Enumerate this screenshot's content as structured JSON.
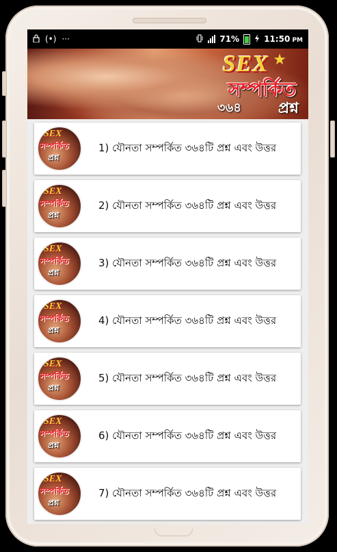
{
  "status_bar": {
    "left_icons": [
      "lock-icon",
      "hotspot-icon",
      "more-icon"
    ],
    "hotspot_symbol": "(•)",
    "more_symbol": "···",
    "battery_percent": "71%",
    "time": "11:50",
    "am_pm": "PM"
  },
  "banner": {
    "sex_text": "SEX",
    "title_line1": "সম্পর্কিত",
    "title_line2": "প্রশ্ন",
    "number": "৩৬৪"
  },
  "thumb": {
    "line1": "SEX",
    "line2": "সম্পর্কিত",
    "line3": "প্রশ্ন"
  },
  "items": [
    {
      "label": "1) যৌনতা সম্পর্কিত ৩৬৪টি প্রশ্ন এবং উত্তর"
    },
    {
      "label": "2) যৌনতা সম্পর্কিত ৩৬৪টি প্রশ্ন এবং উত্তর"
    },
    {
      "label": "3) যৌনতা সম্পর্কিত ৩৬৪টি প্রশ্ন এবং উত্তর"
    },
    {
      "label": "4) যৌনতা সম্পর্কিত ৩৬৪টি প্রশ্ন এবং উত্তর"
    },
    {
      "label": "5) যৌনতা সম্পর্কিত ৩৬৪টি প্রশ্ন এবং উত্তর"
    },
    {
      "label": "6) যৌনতা সম্পর্কিত ৩৬৪টি প্রশ্ন এবং উত্তর"
    },
    {
      "label": "7) যৌনতা সম্পর্কিত ৩৬৪টি প্রশ্ন এবং উত্তর"
    }
  ],
  "colors": {
    "accent_yellow": "#f4d23a",
    "accent_red": "#e81b23",
    "battery_green": "#3ed13e"
  }
}
